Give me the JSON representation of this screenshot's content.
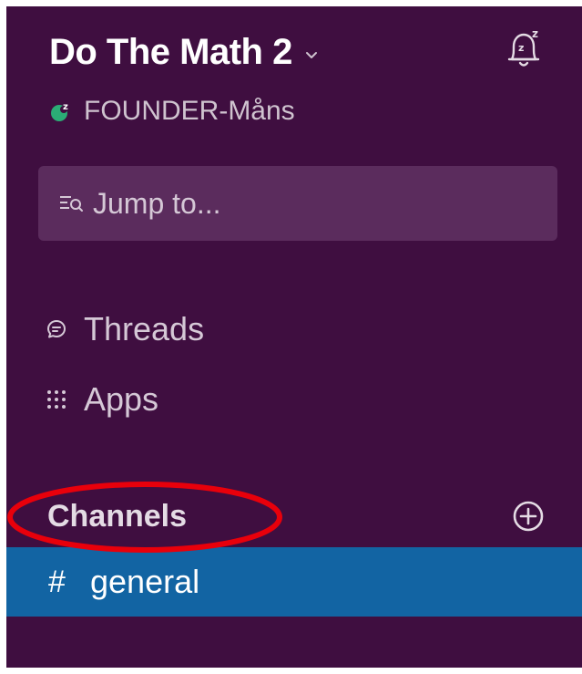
{
  "workspace": {
    "team_name": "Do The Math 2",
    "user_name": "FOUNDER-Måns",
    "presence_icon": "snoozed-presence-icon",
    "snooze_icon": "bell-snooze-icon"
  },
  "search": {
    "jump_label": "Jump to...",
    "icon": "jump-search-icon"
  },
  "nav": {
    "items": [
      {
        "label": "Threads",
        "icon": "threads-icon"
      },
      {
        "label": "Apps",
        "icon": "apps-grid-icon"
      }
    ]
  },
  "channels": {
    "header": "Channels",
    "add_icon": "plus-circle-icon",
    "items": [
      {
        "prefix": "#",
        "name": "general",
        "selected": true
      }
    ]
  },
  "colors": {
    "sidebar_bg": "#3f0e40",
    "selected_channel_bg": "#1264a3",
    "jump_bg": "#5b2c5d",
    "presence_green": "#2bac76",
    "annotation_red": "#e8000b"
  }
}
